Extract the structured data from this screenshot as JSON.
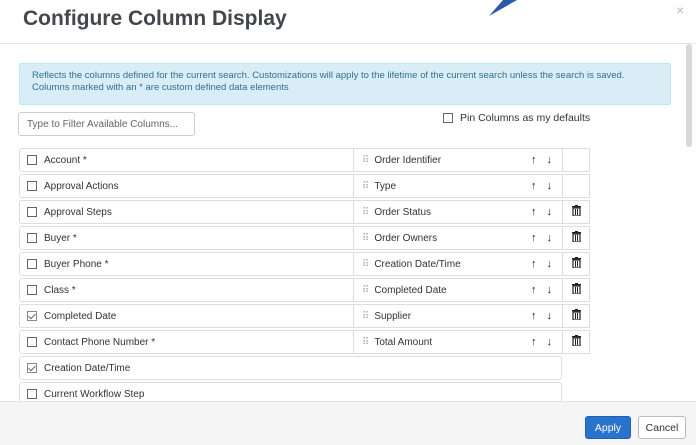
{
  "dialog": {
    "title": "Configure Column Display",
    "close_icon": "close-icon"
  },
  "info_message": "Reflects the columns defined for the current search. Customizations will apply to the lifetime of the current search unless the search is saved. Columns marked with an * are custom defined data elements",
  "filter": {
    "placeholder": "Type to Filter Available Columns..."
  },
  "pin": {
    "label": "Pin Columns as my defaults",
    "checked": false
  },
  "available_columns": [
    {
      "label": "Account *",
      "checked": false
    },
    {
      "label": "Approval Actions",
      "checked": false
    },
    {
      "label": "Approval Steps",
      "checked": false
    },
    {
      "label": "Buyer *",
      "checked": false
    },
    {
      "label": "Buyer Phone *",
      "checked": false
    },
    {
      "label": "Class *",
      "checked": false
    },
    {
      "label": "Completed Date",
      "checked": true
    },
    {
      "label": "Contact Phone Number *",
      "checked": false
    },
    {
      "label": "Creation Date/Time",
      "checked": true
    },
    {
      "label": "Current Workflow Step",
      "checked": false
    }
  ],
  "selected_columns": [
    {
      "label": "Order Identifier",
      "deletable": false
    },
    {
      "label": "Type",
      "deletable": false
    },
    {
      "label": "Order Status",
      "deletable": true
    },
    {
      "label": "Order Owners",
      "deletable": true
    },
    {
      "label": "Creation Date/Time",
      "deletable": true
    },
    {
      "label": "Completed Date",
      "deletable": true
    },
    {
      "label": "Supplier",
      "deletable": true
    },
    {
      "label": "Total Amount",
      "deletable": true
    }
  ],
  "icons": {
    "up": "↑",
    "down": "↓",
    "delete": "🗑",
    "grip": "⠿"
  },
  "footer": {
    "apply_label": "Apply",
    "cancel_label": "Cancel"
  },
  "colors": {
    "primary": "#2a73cc",
    "info_bg": "#d9edf7",
    "info_text": "#31708f"
  }
}
